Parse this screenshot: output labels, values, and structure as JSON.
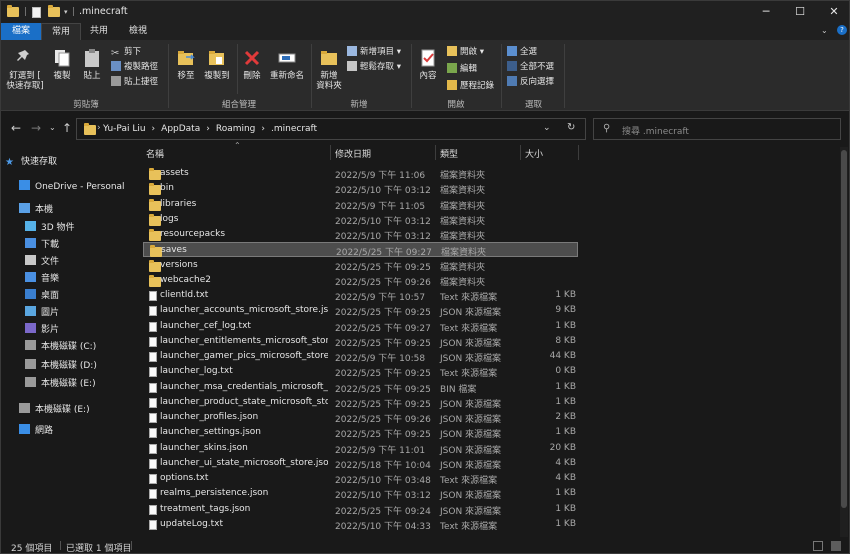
{
  "window": {
    "title": ".minecraft",
    "controls": {
      "minimize": "─",
      "maximize": "☐",
      "close": "✕"
    }
  },
  "tabs": {
    "file": "檔案",
    "home": "常用",
    "share": "共用",
    "view": "檢視"
  },
  "ribbon": {
    "clipboard": {
      "pin": "釘選到 [\n快速存取]",
      "copy": "複製",
      "paste": "貼上",
      "cut": "剪下",
      "copy_path": "複製路徑",
      "paste_shortcut": "貼上捷徑",
      "label": "剪貼簿"
    },
    "organize": {
      "move_to": "移至",
      "copy_to": "複製到",
      "delete": "刪除",
      "rename": "重新命名",
      "label": "組合管理"
    },
    "new": {
      "new_folder": "新增\n資料夾",
      "new_item": "新增項目 ▾",
      "easy_access": "輕鬆存取 ▾",
      "label": "新增"
    },
    "open": {
      "properties": "內容",
      "open": "開啟 ▾",
      "edit": "編輯",
      "history": "歷程記錄",
      "label": "開啟"
    },
    "select": {
      "select_all": "全選",
      "select_none": "全部不選",
      "invert": "反向選擇",
      "label": "選取"
    }
  },
  "address": {
    "crumbs": [
      "Yu-Pai Liu",
      "›",
      "AppData",
      "›",
      "Roaming",
      "›",
      ".minecraft"
    ],
    "search_placeholder": "搜尋 .minecraft"
  },
  "nav": {
    "items": [
      {
        "label": "快速存取",
        "icon": "star-icon"
      },
      {
        "label": "OneDrive - Personal",
        "icon": "cloud-icon"
      },
      {
        "label": "本機",
        "icon": "pc-icon"
      },
      {
        "label": "3D 物件",
        "icon": "cube-icon"
      },
      {
        "label": "下載",
        "icon": "download-icon"
      },
      {
        "label": "文件",
        "icon": "document-icon"
      },
      {
        "label": "音樂",
        "icon": "music-icon"
      },
      {
        "label": "桌面",
        "icon": "desktop-icon"
      },
      {
        "label": "圖片",
        "icon": "pictures-icon"
      },
      {
        "label": "影片",
        "icon": "video-icon"
      },
      {
        "label": "本機磁碟 (C:)",
        "icon": "drive-icon"
      },
      {
        "label": "本機磁碟 (D:)",
        "icon": "drive-icon"
      },
      {
        "label": "本機磁碟 (E:)",
        "icon": "drive-icon"
      },
      {
        "label": "本機磁碟 (E:)",
        "icon": "drive-icon"
      },
      {
        "label": "網路",
        "icon": "network-icon"
      }
    ]
  },
  "columns": {
    "name": "名稱",
    "date": "修改日期",
    "type": "類型",
    "size": "大小"
  },
  "files": [
    {
      "name": "assets",
      "date": "2022/5/9 下午 11:06",
      "type": "檔案資料夾",
      "size": "",
      "kind": "folder"
    },
    {
      "name": "bin",
      "date": "2022/5/10 下午 03:12",
      "type": "檔案資料夾",
      "size": "",
      "kind": "folder"
    },
    {
      "name": "libraries",
      "date": "2022/5/9 下午 11:05",
      "type": "檔案資料夾",
      "size": "",
      "kind": "folder"
    },
    {
      "name": "logs",
      "date": "2022/5/10 下午 03:12",
      "type": "檔案資料夾",
      "size": "",
      "kind": "folder"
    },
    {
      "name": "resourcepacks",
      "date": "2022/5/10 下午 03:12",
      "type": "檔案資料夾",
      "size": "",
      "kind": "folder"
    },
    {
      "name": "saves",
      "date": "2022/5/25 下午 09:27",
      "type": "檔案資料夾",
      "size": "",
      "kind": "folder",
      "selected": true
    },
    {
      "name": "versions",
      "date": "2022/5/25 下午 09:25",
      "type": "檔案資料夾",
      "size": "",
      "kind": "folder"
    },
    {
      "name": "webcache2",
      "date": "2022/5/25 下午 09:26",
      "type": "檔案資料夾",
      "size": "",
      "kind": "folder"
    },
    {
      "name": "clientId.txt",
      "date": "2022/5/9 下午 10:57",
      "type": "Text 來源檔案",
      "size": "1 KB",
      "kind": "file"
    },
    {
      "name": "launcher_accounts_microsoft_store.json",
      "date": "2022/5/25 下午 09:25",
      "type": "JSON 來源檔案",
      "size": "9 KB",
      "kind": "file"
    },
    {
      "name": "launcher_cef_log.txt",
      "date": "2022/5/25 下午 09:27",
      "type": "Text 來源檔案",
      "size": "1 KB",
      "kind": "file"
    },
    {
      "name": "launcher_entitlements_microsoft_store....",
      "date": "2022/5/25 下午 09:25",
      "type": "JSON 來源檔案",
      "size": "8 KB",
      "kind": "file"
    },
    {
      "name": "launcher_gamer_pics_microsoft_store.j...",
      "date": "2022/5/9 下午 10:58",
      "type": "JSON 來源檔案",
      "size": "44 KB",
      "kind": "file"
    },
    {
      "name": "launcher_log.txt",
      "date": "2022/5/25 下午 09:25",
      "type": "Text 來源檔案",
      "size": "0 KB",
      "kind": "file"
    },
    {
      "name": "launcher_msa_credentials_microsoft_st...",
      "date": "2022/5/25 下午 09:25",
      "type": "BIN 檔案",
      "size": "1 KB",
      "kind": "file"
    },
    {
      "name": "launcher_product_state_microsoft_stor...",
      "date": "2022/5/25 下午 09:25",
      "type": "JSON 來源檔案",
      "size": "1 KB",
      "kind": "file"
    },
    {
      "name": "launcher_profiles.json",
      "date": "2022/5/25 下午 09:26",
      "type": "JSON 來源檔案",
      "size": "2 KB",
      "kind": "file"
    },
    {
      "name": "launcher_settings.json",
      "date": "2022/5/25 下午 09:25",
      "type": "JSON 來源檔案",
      "size": "1 KB",
      "kind": "file"
    },
    {
      "name": "launcher_skins.json",
      "date": "2022/5/9 下午 11:01",
      "type": "JSON 來源檔案",
      "size": "20 KB",
      "kind": "file"
    },
    {
      "name": "launcher_ui_state_microsoft_store.json",
      "date": "2022/5/18 下午 10:04",
      "type": "JSON 來源檔案",
      "size": "4 KB",
      "kind": "file"
    },
    {
      "name": "options.txt",
      "date": "2022/5/10 下午 03:48",
      "type": "Text 來源檔案",
      "size": "4 KB",
      "kind": "file"
    },
    {
      "name": "realms_persistence.json",
      "date": "2022/5/10 下午 03:12",
      "type": "JSON 來源檔案",
      "size": "1 KB",
      "kind": "file"
    },
    {
      "name": "treatment_tags.json",
      "date": "2022/5/25 下午 09:24",
      "type": "JSON 來源檔案",
      "size": "1 KB",
      "kind": "file"
    },
    {
      "name": "updateLog.txt",
      "date": "2022/5/10 下午 04:33",
      "type": "Text 來源檔案",
      "size": "1 KB",
      "kind": "file"
    }
  ],
  "status": {
    "count": "25 個項目",
    "selected": "已選取 1 個項目"
  },
  "colors": {
    "accent": "#1a6fc7",
    "folder": "#e8c15a",
    "background": "#191919"
  }
}
